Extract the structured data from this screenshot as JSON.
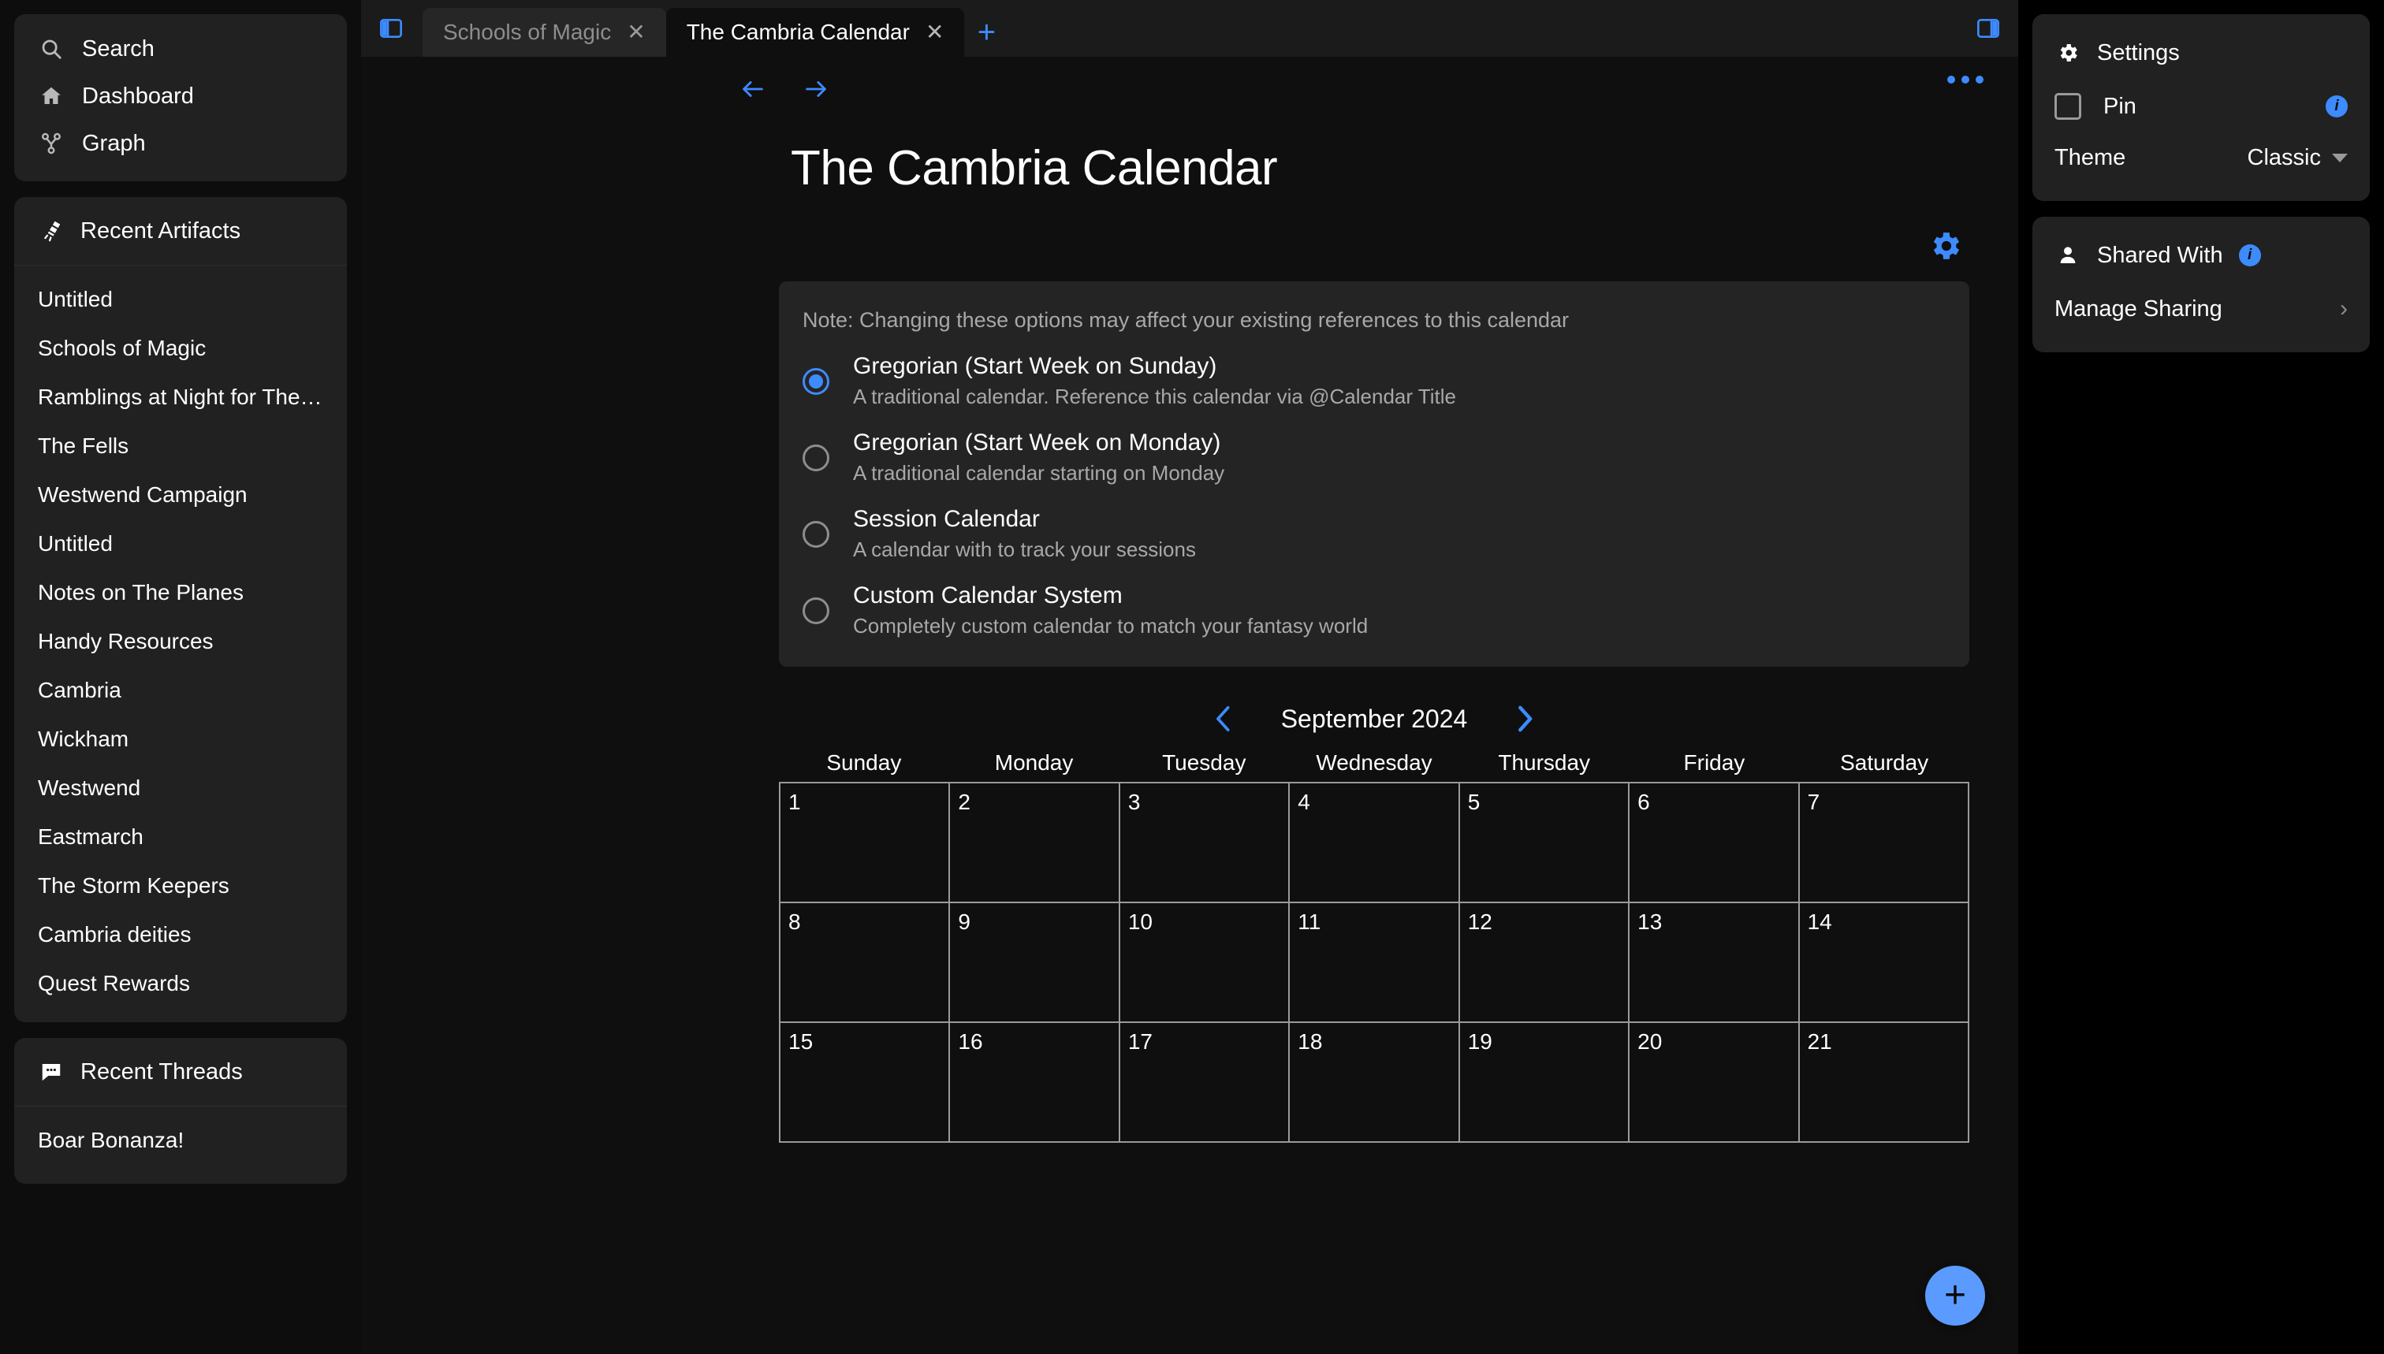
{
  "sidebar": {
    "nav": [
      {
        "label": "Search",
        "icon": "search-icon"
      },
      {
        "label": "Dashboard",
        "icon": "home-icon"
      },
      {
        "label": "Graph",
        "icon": "graph-icon"
      }
    ],
    "artifacts_section": {
      "title": "Recent Artifacts",
      "icon": "telescope-icon"
    },
    "artifacts": [
      "Untitled",
      "Schools of Magic",
      "Ramblings at Night for The …",
      "The Fells",
      "Westwend Campaign",
      "Untitled",
      "Notes on The Planes",
      "Handy Resources",
      "Cambria",
      "Wickham",
      "Westwend",
      "Eastmarch",
      "The Storm Keepers",
      "Cambria deities",
      "Quest Rewards"
    ],
    "threads_section": {
      "title": "Recent Threads",
      "icon": "chat-icon"
    },
    "threads": [
      "Boar Bonanza!"
    ]
  },
  "tabbar": {
    "left_panel_toggle": "left-panel-toggle-icon",
    "right_panel_toggle": "right-panel-toggle-icon",
    "new_tab": "+",
    "close_glyph": "✕",
    "tabs": [
      {
        "label": "Schools of Magic",
        "active": false
      },
      {
        "label": "The Cambria Calendar",
        "active": true
      }
    ]
  },
  "header": {
    "back": "←",
    "forward": "→",
    "overflow": "more-options-icon",
    "title": "The Cambria Calendar",
    "gear": "settings-gear-icon"
  },
  "options": {
    "note": "Note: Changing these options may affect your existing references to this calendar",
    "items": [
      {
        "title": "Gregorian (Start Week on Sunday)",
        "desc": "A traditional calendar. Reference this calendar via @Calendar Title",
        "selected": true
      },
      {
        "title": "Gregorian (Start Week on Monday)",
        "desc": "A traditional calendar starting on Monday",
        "selected": false
      },
      {
        "title": "Session Calendar",
        "desc": "A calendar with to track your sessions",
        "selected": false
      },
      {
        "title": "Custom Calendar System",
        "desc": "Completely custom calendar to match your fantasy world",
        "selected": false
      }
    ]
  },
  "calendar": {
    "prev": "‹",
    "next": "›",
    "month_label": "September 2024",
    "weekdays": [
      "Sunday",
      "Monday",
      "Tuesday",
      "Wednesday",
      "Thursday",
      "Friday",
      "Saturday"
    ],
    "days": [
      "1",
      "2",
      "3",
      "4",
      "5",
      "6",
      "7",
      "8",
      "9",
      "10",
      "11",
      "12",
      "13",
      "14",
      "15",
      "16",
      "17",
      "18",
      "19",
      "20",
      "21"
    ]
  },
  "fab": {
    "label": "+"
  },
  "right_panel": {
    "settings": {
      "title": "Settings",
      "icon": "settings-gear-icon",
      "pin_label": "Pin",
      "pin_info": "i",
      "theme_label": "Theme",
      "theme_value": "Classic"
    },
    "shared": {
      "title": "Shared With",
      "icon": "person-icon",
      "info": "i",
      "manage_label": "Manage Sharing",
      "chevron": "›"
    }
  },
  "colors": {
    "accent": "#3d8bfd",
    "fab": "#5b9bff",
    "card": "#212121",
    "options_card": "#242424",
    "main_bg": "#0f0f0f",
    "sidebar_bg": "#0d0d0d"
  }
}
